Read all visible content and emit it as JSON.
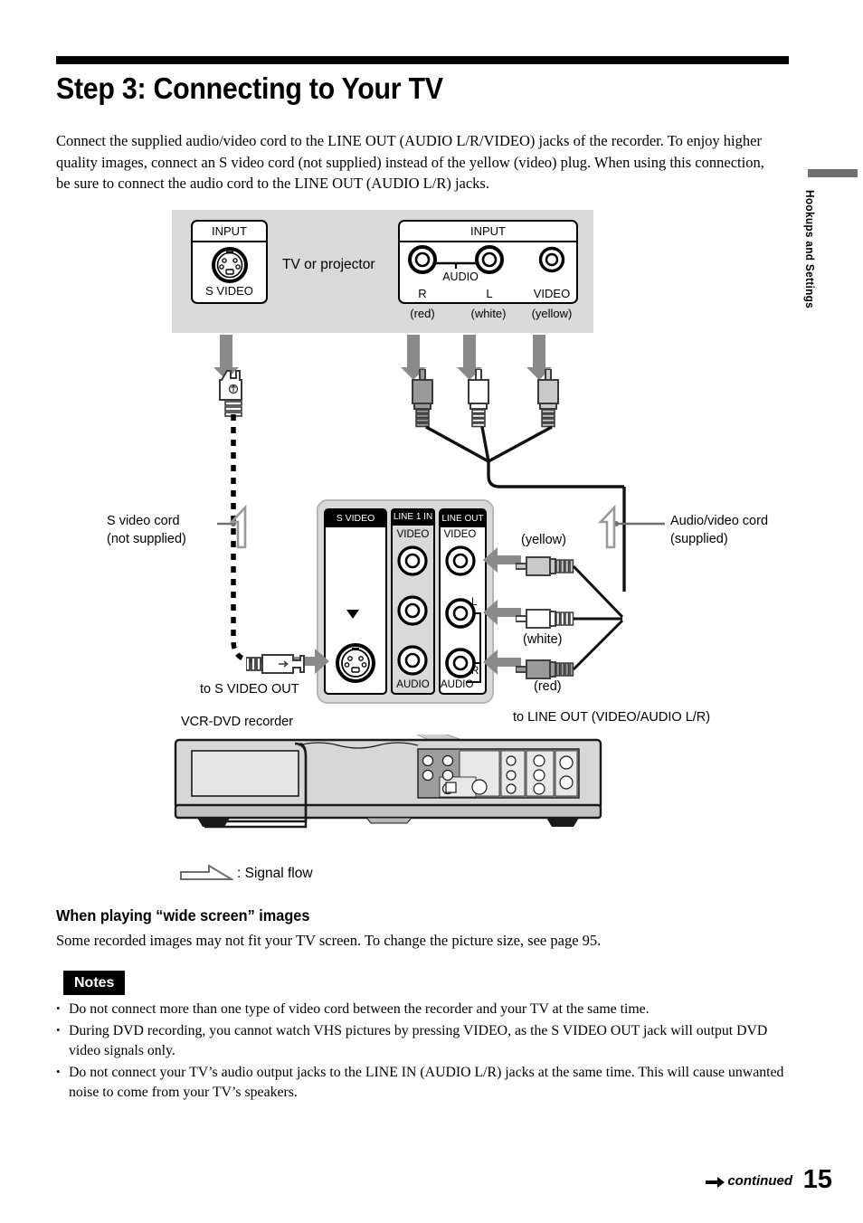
{
  "page": {
    "number": "15",
    "continued_label": "continued",
    "side_tab": "Hookups and Settings"
  },
  "header": {
    "title": "Step 3: Connecting to Your TV",
    "intro": "Connect the supplied audio/video cord to the LINE OUT (AUDIO L/R/VIDEO) jacks of the recorder. To enjoy higher quality images, connect an S video cord (not supplied) instead of the yellow (video) plug. When using this connection, be sure to connect the audio cord to the LINE OUT (AUDIO L/R) jacks."
  },
  "diagram": {
    "tv": {
      "device_label": "TV or projector",
      "svideo_panel": {
        "header": "INPUT",
        "jack_label": "S VIDEO"
      },
      "av_panel": {
        "header": "INPUT",
        "audio_label": "AUDIO",
        "jacks": [
          "R",
          "L",
          "VIDEO"
        ],
        "colors": [
          "(red)",
          "(white)",
          "(yellow)"
        ]
      }
    },
    "recorder": {
      "device_label": "VCR-DVD recorder",
      "panels": [
        {
          "header": "S VIDEO OUT"
        },
        {
          "header": "LINE 1 IN",
          "top_label": "VIDEO",
          "bottom_label": "AUDIO"
        },
        {
          "header": "LINE OUT",
          "top_label": "VIDEO",
          "bottom_label": "AUDIO",
          "l_label": "L",
          "r_label": "R"
        }
      ]
    },
    "cords": {
      "svideo": {
        "name": "S video cord",
        "note": "(not supplied)",
        "to": "to S VIDEO OUT"
      },
      "av": {
        "name": "Audio/video cord",
        "note": "(supplied)",
        "to": "to LINE OUT (VIDEO/AUDIO L/R)"
      },
      "plug_colors": {
        "yellow": "(yellow)",
        "white": "(white)",
        "red": "(red)"
      }
    },
    "legend": ": Signal flow"
  },
  "wide_screen": {
    "heading": "When playing “wide screen” images",
    "body": "Some recorded images may not fit your TV screen. To change the picture size, see page 95."
  },
  "notes": {
    "badge": "Notes",
    "items": [
      "Do not connect more than one type of video cord between the recorder and your TV at the same time.",
      "During DVD recording, you cannot watch VHS pictures by pressing VIDEO, as the S VIDEO OUT jack will output DVD video signals only.",
      "Do not connect your TV’s audio output jacks to the LINE IN (AUDIO L/R) jacks at the same time. This will cause unwanted noise to come from your TV’s speakers."
    ]
  },
  "colors": {
    "panel_gray": "#d9d9d9",
    "arrow_gray": "#8a8a8a",
    "tab_gray": "#6f6f6f",
    "plug_yellow_tone": "#c9c9c9",
    "plug_white_tone": "#ffffff",
    "plug_red_tone": "#9a9a9a"
  }
}
